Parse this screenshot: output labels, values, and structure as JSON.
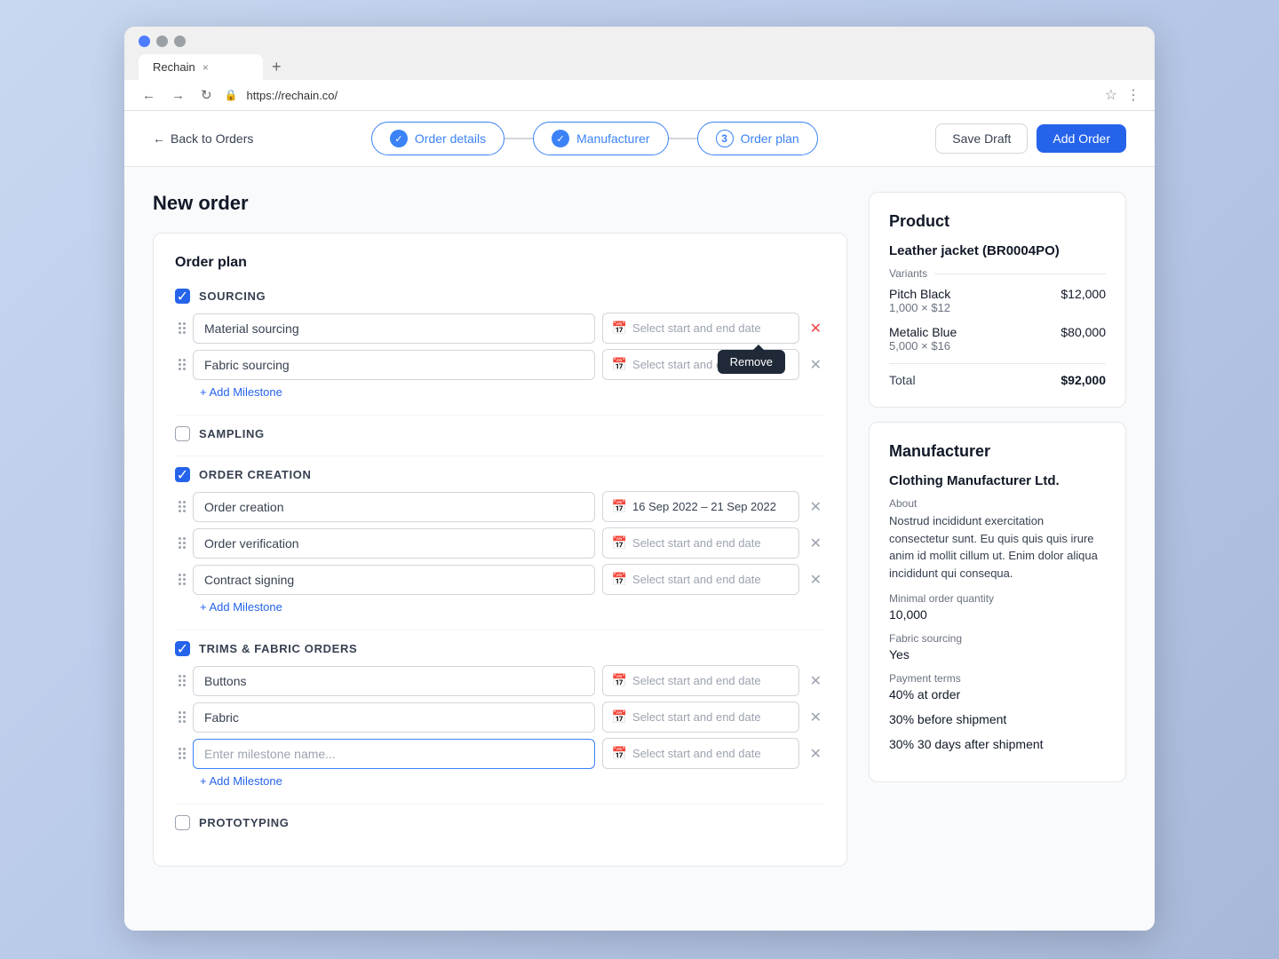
{
  "browser": {
    "tab_title": "Rechain",
    "url": "https://rechain.co/",
    "tab_close": "×",
    "tab_new": "+"
  },
  "header": {
    "back_label": "Back to Orders",
    "steps": [
      {
        "id": "order-details",
        "label": "Order details",
        "state": "completed"
      },
      {
        "id": "manufacturer",
        "label": "Manufacturer",
        "state": "completed"
      },
      {
        "id": "order-plan",
        "label": "Order plan",
        "state": "active",
        "num": "3"
      }
    ],
    "save_draft": "Save Draft",
    "add_order": "Add Order"
  },
  "page": {
    "title": "New order"
  },
  "order_plan": {
    "title": "Order plan",
    "sections": [
      {
        "id": "sourcing",
        "label": "SOURCING",
        "checked": true,
        "milestones": [
          {
            "name": "Material sourcing",
            "date": "Select start and end date",
            "has_date": false
          },
          {
            "name": "Fabric sourcing",
            "date": "Select start and end date",
            "has_date": false
          }
        ],
        "add_milestone": "+ Add Milestone"
      },
      {
        "id": "sampling",
        "label": "SAMPLING",
        "checked": false,
        "milestones": []
      },
      {
        "id": "order-creation",
        "label": "ORDER CREATION",
        "checked": true,
        "milestones": [
          {
            "name": "Order creation",
            "date": "16 Sep 2022 – 21 Sep 2022",
            "has_date": true
          },
          {
            "name": "Order verification",
            "date": "Select start and end date",
            "has_date": false
          },
          {
            "name": "Contract signing",
            "date": "Select start and end date",
            "has_date": false
          }
        ],
        "add_milestone": "+ Add Milestone"
      },
      {
        "id": "trims-fabric",
        "label": "TRIMS & FABRIC ORDERS",
        "checked": true,
        "milestones": [
          {
            "name": "Buttons",
            "date": "Select start and end date",
            "has_date": false
          },
          {
            "name": "Fabric",
            "date": "Select start and end date",
            "has_date": false
          },
          {
            "name": "",
            "date": "Select start and end date",
            "has_date": false,
            "placeholder": "Enter milestone name..."
          }
        ],
        "add_milestone": "+ Add Milestone"
      },
      {
        "id": "prototyping",
        "label": "PROTOTYPING",
        "checked": false,
        "milestones": []
      }
    ]
  },
  "tooltip": {
    "label": "Remove"
  },
  "product": {
    "section_title": "Product",
    "name": "Leather jacket (BR0004PO)",
    "variants_label": "Variants",
    "variants": [
      {
        "name": "Pitch Black",
        "qty": "1,000 × $12",
        "price": "$12,000"
      },
      {
        "name": "Metalic Blue",
        "qty": "5,000 × $16",
        "price": "$80,000"
      }
    ],
    "total_label": "Total",
    "total_value": "$92,000"
  },
  "manufacturer": {
    "section_title": "Manufacturer",
    "name": "Clothing Manufacturer Ltd.",
    "about_label": "About",
    "about_text": "Nostrud incididunt exercitation consectetur sunt. Eu quis quis quis irure anim id mollit cillum ut. Enim dolor aliqua incididunt qui consequa.",
    "moq_label": "Minimal order quantity",
    "moq_value": "10,000",
    "fabric_label": "Fabric sourcing",
    "fabric_value": "Yes",
    "payment_label": "Payment terms",
    "payment_line1": "40% at order",
    "payment_line2": "30% before shipment",
    "payment_line3": "30% 30 days after shipment"
  },
  "icons": {
    "check": "✓",
    "calendar": "📅",
    "drag": "⠿"
  }
}
